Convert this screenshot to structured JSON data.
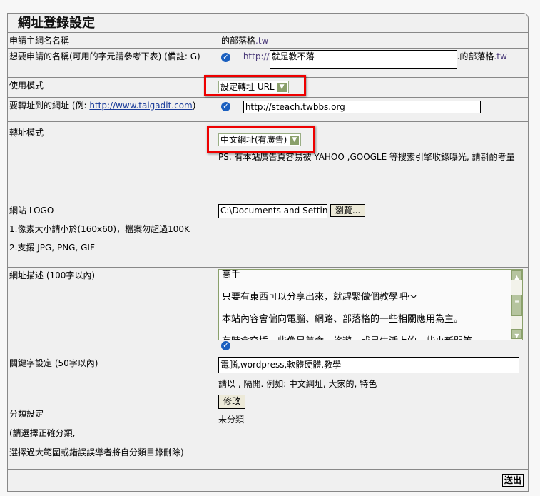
{
  "title": "網址登錄設定",
  "rows": {
    "main_domain": {
      "label": "申請主網名名稱",
      "value": "的部落格",
      "suffix": ".tw"
    },
    "name": {
      "label": "想要申請的名稱(可用的字元請參考下表) (備註: G)",
      "prefix": "http://",
      "value": "就是教不落",
      "suffix": ".的部落格",
      "tld": ".tw"
    },
    "mode": {
      "label": "使用模式",
      "selected": "設定轉址 URL"
    },
    "target": {
      "label": "要轉址到的網址 (例: ",
      "link": "http://www.taigadit.com",
      "label_end": ")",
      "value": "http://steach.twbbs.org"
    },
    "redirect": {
      "label": "轉址模式",
      "selected": "中文網址(有廣告)",
      "note": "PS. 有本站廣告頁容易被 YAHOO ,GOOGLE 等搜索引擎收錄曝光, 請斟酌考量"
    },
    "logo": {
      "label": "網站 LOGO",
      "rule1": "1.像素大小請小於(160x60)，檔案勿超過100K",
      "rule2": "2.支援 JPG, PNG, GIF",
      "file": "C:\\Documents and Setting",
      "browse": "瀏覽..."
    },
    "desc": {
      "label": "網址描述 (100字以內)",
      "lines": [
        "高手",
        "只要有東西可以分享出來，就趕緊做個教學吧～",
        "本站內容會偏向電腦、網路、部落格的一些相關應用為主。",
        "有時會穿插一些像是美食、旅遊、或是生活上的一些小新聞等"
      ]
    },
    "keywords": {
      "label": "關鍵字設定 (50字以內)",
      "value": "電腦,wordpress,軟體硬體,教學",
      "hint": "請以 , 隔開. 例如: 中文網址, 大家的, 特色"
    },
    "category": {
      "label": "分類設定",
      "note1": "(請選擇正確分類,",
      "note2": "選擇過大範圍或錯誤誤導者將自分類目錄刪除)",
      "edit": "修改",
      "value": "未分類"
    }
  },
  "submit": "送出",
  "colors": {
    "highlight": "#e00000",
    "check": "#1a5fbf"
  }
}
